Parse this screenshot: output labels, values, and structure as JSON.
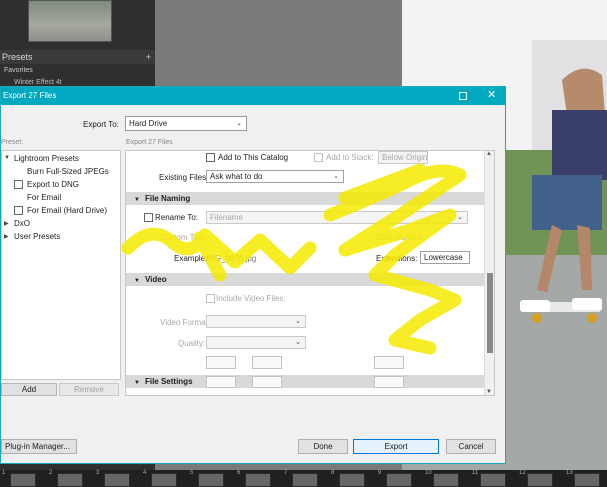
{
  "lightroom": {
    "presets_header": "Presets",
    "presets_plus": "+",
    "favorites_label": "Favorites",
    "winter_item": "Winter Effect 4t",
    "filmstrip_numbers": [
      "1",
      "2",
      "3",
      "4",
      "5",
      "6",
      "7",
      "8",
      "9",
      "10",
      "11",
      "12",
      "13"
    ]
  },
  "dialog": {
    "title": "Export 27 Files",
    "export_to_label": "Export To:",
    "export_to_value": "Hard Drive",
    "preset_label": "Preset:",
    "export_count": "Export 27 Files",
    "presets": [
      {
        "label": "Lightroom Presets",
        "checkbox": false,
        "expanded": true
      },
      {
        "label": "Burn Full-Sized JPEGs",
        "checkbox": false
      },
      {
        "label": "Export to DNG",
        "checkbox": true
      },
      {
        "label": "For Email",
        "checkbox": false
      },
      {
        "label": "For Email (Hard Drive)",
        "checkbox": true
      },
      {
        "label": "DxO",
        "checkbox": false,
        "expanded": false
      },
      {
        "label": "User Presets",
        "checkbox": false,
        "expanded": false
      }
    ],
    "add_label": "Add",
    "remove_label": "Remove",
    "plugin_label": "Plug-in Manager...",
    "done_label": "Done",
    "export_label": "Export",
    "cancel_label": "Cancel",
    "settings": {
      "add_to_catalog": "Add to This Catalog",
      "add_to_stack": "Add to Stack:",
      "below_original": "Below Original",
      "existing_files_label": "Existing Files:",
      "existing_files_value": "Ask what to do",
      "file_naming": "File Naming",
      "rename_to": "Rename To:",
      "filename_value": "Filename",
      "custom_text": "Custom Text:",
      "start_number": "Start Number:",
      "example_label": "Example:",
      "example_value": "IMG_0076.jpg",
      "extensions_label": "Extensions:",
      "extensions_value": "Lowercase",
      "video": "Video",
      "include_video": "Include Video Files:",
      "video_format": "Video Format:",
      "quality": "Quality:",
      "file_settings": "File Settings"
    }
  },
  "colors": {
    "titlebar": "#00a8c0",
    "scribble": "#f6ea00",
    "export_button_border": "#0078d7"
  }
}
